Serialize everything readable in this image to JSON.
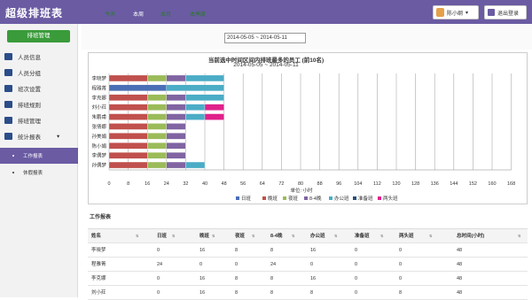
{
  "app": {
    "title": "超级排班表"
  },
  "user": {
    "name": "陈小纲",
    "logout": "退出登录"
  },
  "sidebar": {
    "main_button": "排班管理",
    "items": [
      "人员信息",
      "人员分组",
      "班次设置",
      "排班规则",
      "排班管理",
      "统计报表"
    ],
    "subitems": [
      "工作报表",
      "休假报表"
    ]
  },
  "toolbar": {
    "tabs": [
      "今天",
      "本周",
      "本月",
      "本季度"
    ],
    "active_tab": 1,
    "range": "2014-05-05 ~ 2014-05-11"
  },
  "colors": {
    "accent": "#6a5ba3",
    "green": "#3a9b3a"
  },
  "chart_data": {
    "type": "bar",
    "orientation": "horizontal",
    "stacked": true,
    "title": "当前选中时间区间内排班最多的员工 (前10名)",
    "subtitle": "2014-05-05 ~ 2014-05-11",
    "xlabel": "单位: 小时",
    "xlim": [
      0,
      72
    ],
    "xticks": [
      "0",
      "8",
      "16",
      "24",
      "32",
      "40",
      "48",
      "56",
      "64",
      "72",
      "80",
      "88",
      "96",
      "104",
      "112",
      "120",
      "128",
      "136",
      "144",
      "152",
      "160",
      "168"
    ],
    "categories": [
      "李晓梦",
      "程雅菁",
      "李克娜",
      "刘小荭",
      "朱鹏甫",
      "张倩娜",
      "孙美娟",
      "陈小娟",
      "李偶梦",
      "孙偶梦"
    ],
    "series": [
      {
        "name": "日班",
        "color": "#4a6fb5",
        "values": [
          0,
          24,
          0,
          0,
          0,
          0,
          0,
          0,
          0,
          0
        ]
      },
      {
        "name": "晚班",
        "color": "#c0504d",
        "values": [
          16,
          0,
          16,
          16,
          16,
          16,
          16,
          16,
          16,
          16
        ]
      },
      {
        "name": "夜班",
        "color": "#9bbb59",
        "values": [
          8,
          0,
          8,
          8,
          8,
          8,
          8,
          8,
          8,
          8
        ]
      },
      {
        "name": "8-4晚",
        "color": "#8064a2",
        "values": [
          8,
          0,
          8,
          8,
          8,
          8,
          8,
          8,
          8,
          8
        ]
      },
      {
        "name": "办公班",
        "color": "#4bacc6",
        "values": [
          16,
          24,
          16,
          8,
          8,
          0,
          0,
          0,
          0,
          8
        ]
      },
      {
        "name": "准备班",
        "color": "#2c4d75",
        "values": [
          0,
          0,
          0,
          0,
          0,
          0,
          0,
          0,
          0,
          0
        ]
      },
      {
        "name": "两头班",
        "color": "#e0218a",
        "values": [
          0,
          0,
          0,
          8,
          8,
          0,
          0,
          0,
          0,
          0
        ]
      }
    ]
  },
  "report": {
    "title": "工作报表",
    "headers": [
      "姓名",
      "日班",
      "晚班",
      "夜班",
      "8-4晚",
      "办公班",
      "准备班",
      "两头班",
      "总时间(小时)"
    ],
    "rows": [
      [
        "李晓梦",
        "0",
        "16",
        "8",
        "8",
        "16",
        "0",
        "0",
        "48"
      ],
      [
        "程雅菁",
        "24",
        "0",
        "0",
        "24",
        "0",
        "0",
        "0",
        "48"
      ],
      [
        "李克娜",
        "0",
        "16",
        "8",
        "8",
        "16",
        "0",
        "0",
        "48"
      ],
      [
        "刘小荭",
        "0",
        "16",
        "8",
        "8",
        "8",
        "0",
        "8",
        "48"
      ]
    ]
  }
}
